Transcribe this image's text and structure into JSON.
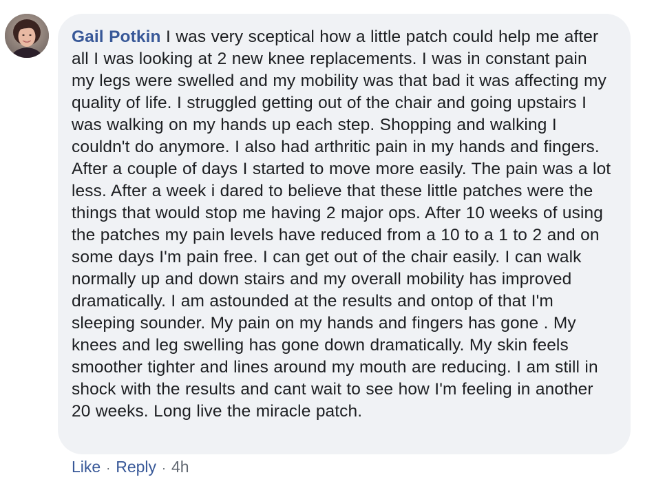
{
  "comment": {
    "author": "Gail Potkin",
    "text": "I was very sceptical how a little patch could help me after all I was looking at 2 new knee replacements. I was in constant pain my legs were swelled and my mobility was that bad it was affecting my quality of life. I struggled getting out of the chair and going upstairs I was walking on my hands up each step. Shopping and walking I couldn't do anymore. I also had arthritic pain in my hands and fingers. After a couple of days I started to move more easily. The pain was a lot less. After a week i dared to believe that these little patches were the things that would stop me having 2 major ops. After 10 weeks of using the patches my pain levels have reduced from a 10 to a 1 to 2 and on some days I'm pain free. I can get out of the chair easily. I can walk normally up and down stairs and my overall mobility has improved dramatically. I am astounded at the results and ontop of that I'm sleeping sounder. My pain on my hands and fingers has gone . My knees and leg swelling has gone down dramatically. My skin feels smoother tighter and lines around my mouth are reducing. I am still in shock with the results and cant wait to see how I'm feeling in another 20 weeks. Long live the miracle patch."
  },
  "actions": {
    "like_label": "Like",
    "separator": "·",
    "reply_label": "Reply",
    "timestamp": "4h"
  },
  "colors": {
    "author_link": "#385898",
    "bubble_background": "#f0f2f5",
    "body_text": "#1c1e21",
    "meta_text": "#606770"
  }
}
